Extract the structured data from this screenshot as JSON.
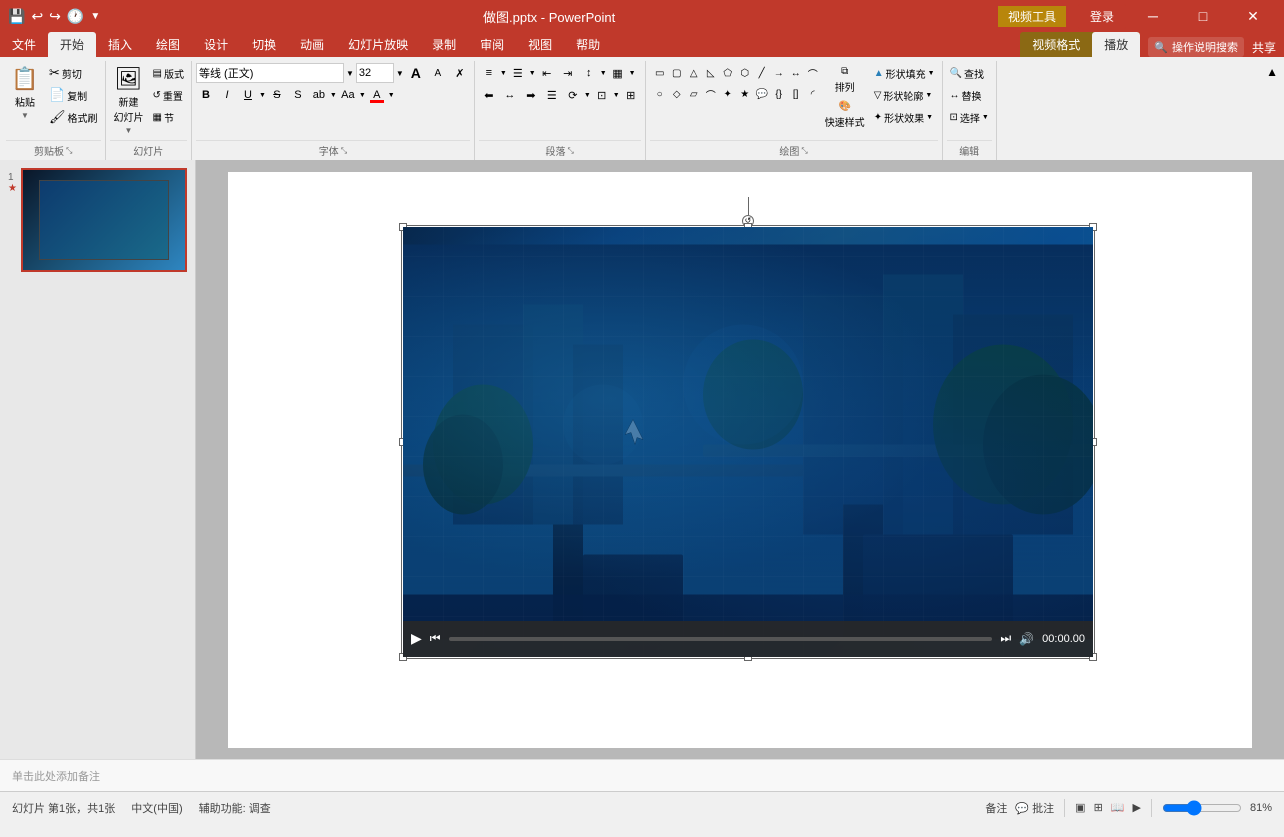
{
  "titlebar": {
    "filename": "做图.pptx - PowerPoint",
    "context_tab": "视频工具",
    "login_label": "登录",
    "minimize": "─",
    "maximize": "□",
    "close": "✕"
  },
  "tabs": {
    "context_label": "视频工具",
    "items": [
      "文件",
      "开始",
      "插入",
      "绘图",
      "设计",
      "切换",
      "动画",
      "幻灯片放映",
      "录制",
      "审阅",
      "视图",
      "帮助",
      "视频格式",
      "播放"
    ],
    "active": "开始",
    "active_context": "播放",
    "help_icon": "?",
    "search_placeholder": "操作说明搜索",
    "share_label": "共享"
  },
  "ribbon": {
    "groups": {
      "clipboard": {
        "label": "剪贴板",
        "paste": "粘贴",
        "cut": "剪切",
        "copy": "复制",
        "format_painter": "格式刷"
      },
      "slides": {
        "label": "幻灯片",
        "new_slide": "新建\n幻灯片",
        "layout": "版式",
        "reset": "重置",
        "section": "节"
      },
      "font": {
        "label": "字体",
        "name": "等线 (正文)",
        "size": "32",
        "size_up": "A",
        "size_down": "A",
        "clear": "✗",
        "bold": "B",
        "italic": "I",
        "underline": "U",
        "strikethrough": "S",
        "shadow": "S",
        "char_spacing": "ab",
        "case": "Aa",
        "color": "A"
      },
      "paragraph": {
        "label": "段落",
        "bullets": "≡",
        "numbering": "1≡",
        "indent_dec": "←",
        "indent_inc": "→",
        "left": "≡",
        "center": "≡",
        "right": "≡",
        "justify": "≡",
        "columns": "▦",
        "line_spacing": "↕",
        "direction": "↔"
      },
      "drawing": {
        "label": "绘图",
        "shapes": "shapes",
        "arrange": "排列",
        "quick_styles": "快速样式",
        "fill": "形状填充",
        "outline": "形状轮廓",
        "effect": "形状效果"
      },
      "editing": {
        "label": "编辑",
        "find": "查找",
        "replace": "替换",
        "select": "选择"
      }
    }
  },
  "slide": {
    "number": 1,
    "total": 1,
    "star": "★"
  },
  "video": {
    "time": "00:00.00",
    "play": "▶",
    "skip_back": "⏮",
    "skip_fwd": "⏭",
    "volume": "🔊"
  },
  "statusbar": {
    "slide_info": "幻灯片 第1张，共1张",
    "language": "中文(中国)",
    "accessibility": "辅助功能: 调查",
    "notes": "备注",
    "comments": "批注",
    "normal_view": "▣",
    "slide_sorter": "⊞",
    "reading_view": "📖",
    "slideshow": "▶",
    "zoom": "81%",
    "zoom_label": "81%",
    "notes_placeholder": "单击此处添加备注"
  },
  "colors": {
    "ribbon_red": "#c0392b",
    "context_gold": "#8B6914",
    "accent_blue": "#2980b9"
  }
}
